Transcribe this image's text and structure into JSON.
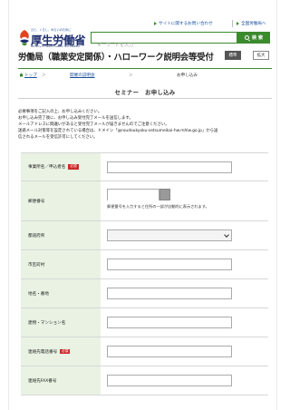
{
  "header": {
    "utility_links": [
      "サイトに関するお問い合わせ",
      "全国労働局へ"
    ],
    "logo": {
      "tagline": "ひと、くらし、みらいのために",
      "name": "厚生労働省",
      "name_en": "Ministry of Health, Labour and Welfare"
    },
    "search": {
      "placeholder": "キーワードを入力",
      "button_label": "検 索"
    },
    "title": "労働局（職業安定関係）・ハローワーク説明会等受付",
    "text_size_buttons": [
      "標準",
      "拡大"
    ],
    "icons": [
      "search-icon",
      "arrow-right-icon",
      "home-icon"
    ]
  },
  "breadcrumb": [
    "トップ",
    "開催の説明会",
    "お申し込み"
  ],
  "page_heading": "セミナー　お申し込み",
  "notes": [
    "必要事項をご記入の上、お申し込みください。",
    "お申し込み完了後に、お申し込み受付完了メールを送信します。",
    "メールアドレスに間違いがあると受付完了メールが届きませんのでご注意ください。",
    "迷惑メール対策等を設定されている場合は、ドメイン「@roudoukyoku-setsumeikai-hw.mhlw.go.jp」から送",
    "信されるメールを受信許可にしてください。"
  ],
  "form": {
    "required_badge": "必須",
    "fields": [
      {
        "label": "事業所名／申込者名",
        "required": true,
        "type": "text",
        "value": ""
      },
      {
        "label": "郵便番号",
        "required": false,
        "type": "zip",
        "value": "",
        "help": "郵便番号を入力すると住所の一部が自動的に表示されます。"
      },
      {
        "label": "都道府県",
        "required": false,
        "type": "select",
        "value": ""
      },
      {
        "label": "市区町村",
        "required": false,
        "type": "text",
        "value": ""
      },
      {
        "label": "地名・番地",
        "required": false,
        "type": "text",
        "value": ""
      },
      {
        "label": "建物・マンション名",
        "required": false,
        "type": "text",
        "value": ""
      },
      {
        "label": "連絡先電話番号",
        "required": true,
        "type": "text",
        "value": ""
      },
      {
        "label": "連絡先FAX番号",
        "required": false,
        "type": "text",
        "value": ""
      }
    ]
  },
  "colors": {
    "accent": "#3c8a2e",
    "label_bg": "#e9f2e3",
    "required": "#cc2a2a",
    "link": "#1a4f9c"
  }
}
